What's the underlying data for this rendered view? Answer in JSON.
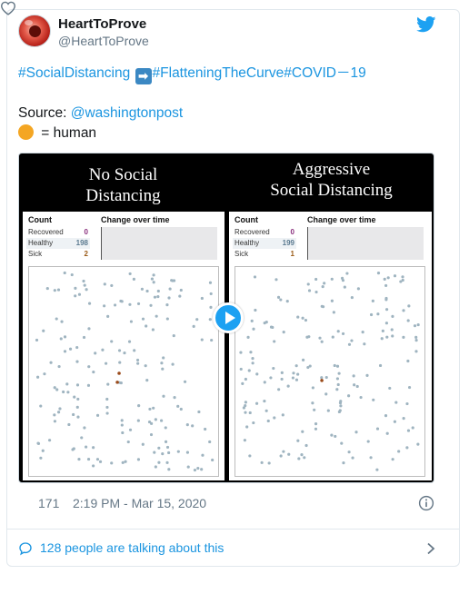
{
  "user": {
    "display_name": "HeartToProve",
    "handle": "@HeartToProve"
  },
  "tweet": {
    "hashtag_1": "#SocialDistancing",
    "arrow_emoji": "➡",
    "hashtag_2": "#FlatteningTheCurve#COVID－19",
    "source_label": "Source: ",
    "source_link": "@washingtonpost",
    "legend_text": " = human",
    "legend_dot_color": "#f4a623"
  },
  "media": {
    "left_panel": {
      "title_line1": "No Social",
      "title_line2": "Distancing",
      "count_header": "Count",
      "change_header": "Change over time",
      "stats": [
        {
          "label": "Recovered",
          "value": "0"
        },
        {
          "label": "Healthy",
          "value": "198"
        },
        {
          "label": "Sick",
          "value": "2"
        }
      ]
    },
    "right_panel": {
      "title_line1": "Aggressive",
      "title_line2": "Social Distancing",
      "count_header": "Count",
      "change_header": "Change over time",
      "stats": [
        {
          "label": "Recovered",
          "value": "0"
        },
        {
          "label": "Healthy",
          "value": "199"
        },
        {
          "label": "Sick",
          "value": "1"
        }
      ]
    },
    "play_icon": "play-icon",
    "healthy_dot_color": "#9fb4c0",
    "sick_dot_color": "#9a4a1a"
  },
  "footer": {
    "like_count": "171",
    "timestamp": "2:19 PM - Mar 15, 2020",
    "talking": "128 people are talking about this"
  },
  "colors": {
    "link": "#1b95e0",
    "twitter_blue": "#1da1f2",
    "meta_gray": "#657786"
  }
}
